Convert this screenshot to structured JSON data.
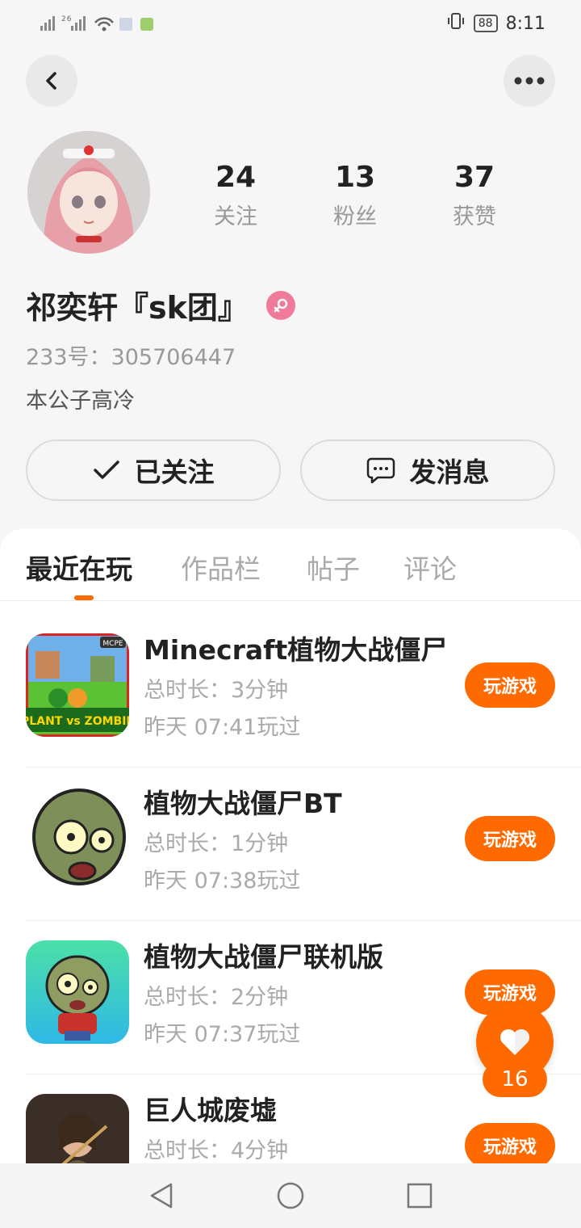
{
  "status_bar": {
    "signal_text": "26",
    "battery": "88",
    "time": "8:11"
  },
  "header": {
    "back_icon": "chevron-left-icon",
    "more_icon": "more-horizontal-icon"
  },
  "profile": {
    "stats": [
      {
        "value": "24",
        "label": "关注"
      },
      {
        "value": "13",
        "label": "粉丝"
      },
      {
        "value": "37",
        "label": "获赞"
      }
    ],
    "name": "祁奕轩『sk团』",
    "gender_icon": "female-icon",
    "id_line": "233号：305706447",
    "bio": "本公子高冷"
  },
  "actions": {
    "follow_label": "已关注",
    "message_label": "发消息"
  },
  "tabs": [
    {
      "label": "最近在玩",
      "active": true
    },
    {
      "label": "作品栏",
      "active": false
    },
    {
      "label": "帖子",
      "active": false
    },
    {
      "label": "评论",
      "active": false
    }
  ],
  "games": [
    {
      "title": "Minecraft植物大战僵尸",
      "duration": "总时长：3分钟",
      "last_played": "昨天 07:41玩过",
      "play_label": "玩游戏"
    },
    {
      "title": "植物大战僵尸BT",
      "duration": "总时长：1分钟",
      "last_played": "昨天 07:38玩过",
      "play_label": "玩游戏"
    },
    {
      "title": "植物大战僵尸联机版",
      "duration": "总时长：2分钟",
      "last_played": "昨天 07:37玩过",
      "play_label": "玩游戏"
    },
    {
      "title": "巨人城废墟",
      "duration": "总时长：4分钟",
      "last_played": "",
      "play_label": "玩游戏"
    }
  ],
  "like_fab": {
    "count": "16"
  },
  "colors": {
    "accent": "#ff6a00",
    "background": "#f6f6f6"
  }
}
